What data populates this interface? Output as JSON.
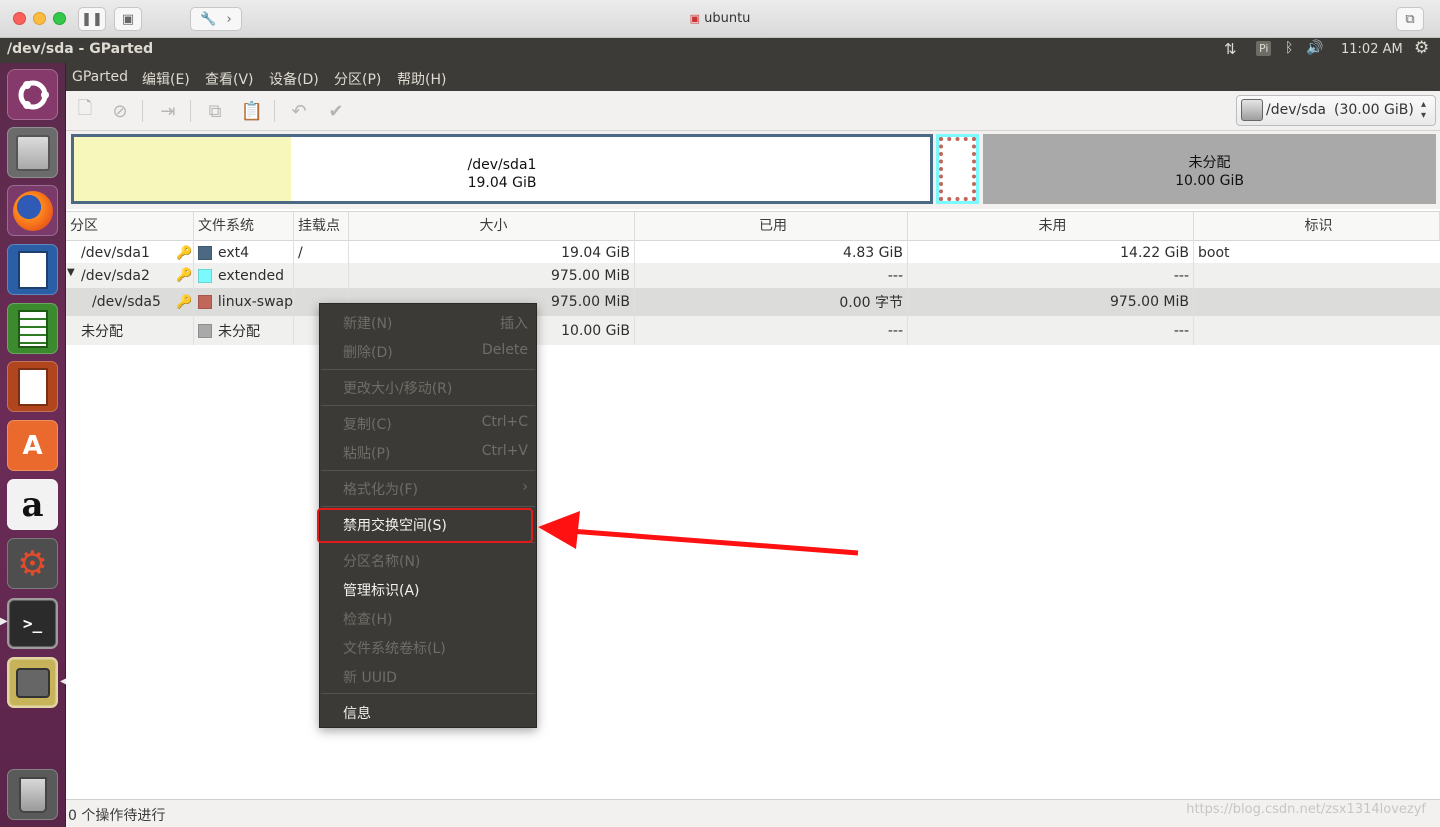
{
  "mac_window": {
    "title": "ubuntu"
  },
  "topbar": {
    "title": "/dev/sda - GParted",
    "indicator_pi": "Pi",
    "time": "11:02 AM"
  },
  "launcher": {
    "items": [
      "ubuntu-logo",
      "files",
      "firefox",
      "writer",
      "calc",
      "impress",
      "software-center",
      "amazon",
      "system-settings",
      "terminal",
      "gparted",
      "trash"
    ],
    "amazon_glyph": "a"
  },
  "menubar": {
    "items": [
      "GParted",
      "编辑(E)",
      "查看(V)",
      "设备(D)",
      "分区(P)",
      "帮助(H)"
    ]
  },
  "device_selector": {
    "label": "/dev/sda",
    "size": "(30.00 GiB)"
  },
  "disk_map": {
    "sda1": {
      "name": "/dev/sda1",
      "size": "19.04 GiB"
    },
    "unallocated": {
      "name": "未分配",
      "size": "10.00 GiB"
    }
  },
  "colors": {
    "ext4": "#4b6983",
    "extended": "#7bf9fd",
    "linux_swap": "#c1665a",
    "unallocated": "#a9a9a9",
    "highlight": "#e41b1b"
  },
  "table": {
    "headers": [
      "分区",
      "文件系统",
      "挂载点",
      "大小",
      "已用",
      "未用",
      "标识"
    ],
    "rows": [
      {
        "partition": "/dev/sda1",
        "fs": "ext4",
        "mount": "/",
        "size": "19.04 GiB",
        "used": "4.83 GiB",
        "unused": "14.22 GiB",
        "flags": "boot"
      },
      {
        "partition": "/dev/sda2",
        "fs": "extended",
        "mount": "",
        "size": "975.00 MiB",
        "used": "---",
        "unused": "---",
        "flags": ""
      },
      {
        "partition": "/dev/sda5",
        "fs": "linux-swap",
        "mount": "",
        "size": "975.00 MiB",
        "used": "0.00 字节",
        "unused": "975.00 MiB",
        "flags": ""
      },
      {
        "partition": "未分配",
        "fs": "未分配",
        "mount": "",
        "size": "10.00 GiB",
        "used": "---",
        "unused": "---",
        "flags": ""
      }
    ]
  },
  "context_menu": {
    "new": {
      "label": "新建(N)",
      "accel": "插入"
    },
    "delete": {
      "label": "删除(D)",
      "accel": "Delete"
    },
    "resize": {
      "label": "更改大小/移动(R)"
    },
    "copy": {
      "label": "复制(C)",
      "accel": "Ctrl+C"
    },
    "paste": {
      "label": "粘贴(P)",
      "accel": "Ctrl+V"
    },
    "format": {
      "label": "格式化为(F)",
      "accel": "›"
    },
    "swapoff": {
      "label": "禁用交换空间(S)"
    },
    "name": {
      "label": "分区名称(N)"
    },
    "flags": {
      "label": "管理标识(A)"
    },
    "check": {
      "label": "检查(H)"
    },
    "label": {
      "label": "文件系统卷标(L)"
    },
    "uuid": {
      "label": "新 UUID"
    },
    "info": {
      "label": "信息"
    }
  },
  "statusbar": {
    "text": "0 个操作待进行",
    "watermark": "https://blog.csdn.net/zsx1314lovezyf"
  }
}
